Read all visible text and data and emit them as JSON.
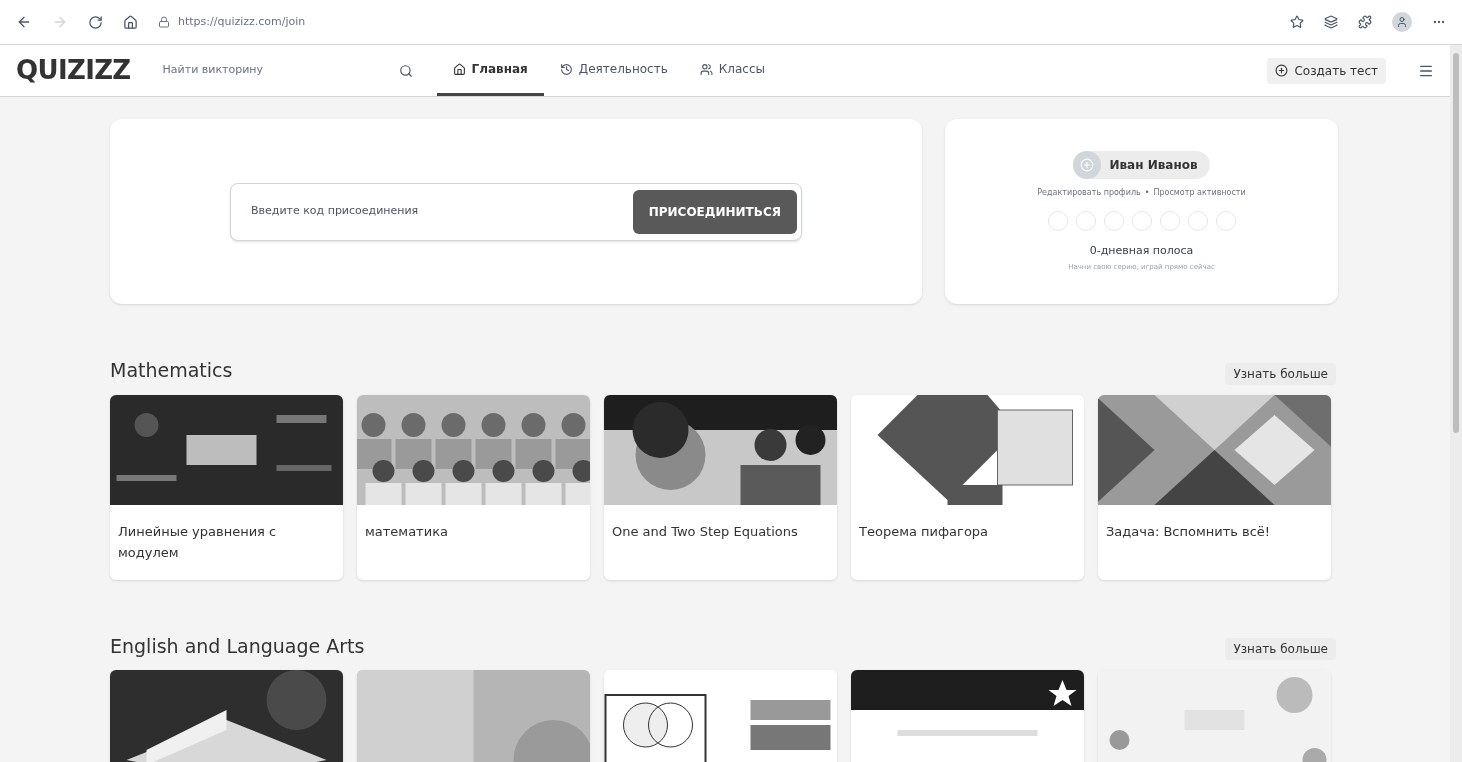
{
  "browser": {
    "url": "https://quizizz.com/join"
  },
  "header": {
    "logo": "QUIZIZZ",
    "search": {
      "placeholder": "Найти викторину"
    },
    "tabs": [
      {
        "label": "Главная",
        "selected": true
      },
      {
        "label": "Деятельность",
        "selected": false
      },
      {
        "label": "Классы",
        "selected": false
      }
    ],
    "create_button": "Создать тест"
  },
  "join": {
    "placeholder": "Введите код присоединения",
    "button": "ПРИСОЕДИНИТЬСЯ"
  },
  "profile": {
    "name": "Иван Иванов",
    "links": [
      "Редактировать профиль",
      "Просмотр активности"
    ],
    "separator": "•",
    "streak_title": "0-дневная полоса",
    "streak_hint": "Начни свою серию, играй прямо сейчас"
  },
  "sections": [
    {
      "title": "Mathematics",
      "more": "Узнать больше",
      "cards": [
        {
          "title": "Линейные уравнения с модулем",
          "kind": "picture"
        },
        {
          "title": "математика",
          "kind": "picture"
        },
        {
          "title": "One and Two Step Equations",
          "kind": "picture"
        },
        {
          "title": "Теорема пифагора",
          "kind": "picture"
        },
        {
          "title": "Задача: Вспомнить всё!",
          "kind": "picture"
        }
      ]
    },
    {
      "title": "English and Language Arts",
      "more": "Узнать больше"
    }
  ]
}
